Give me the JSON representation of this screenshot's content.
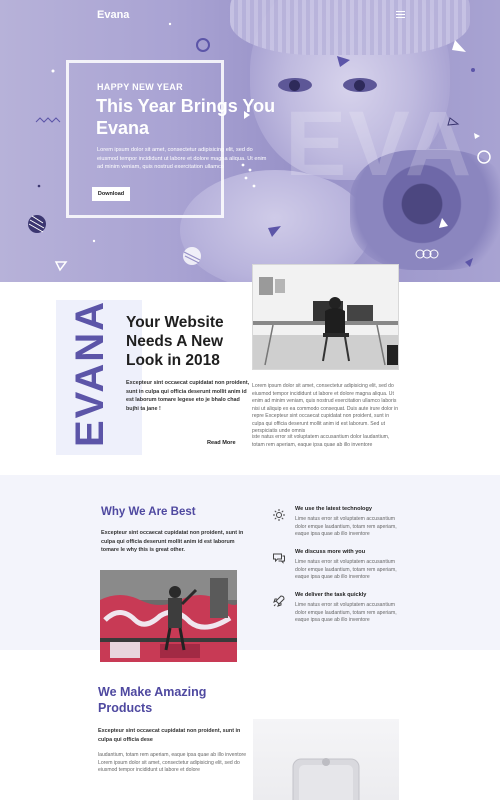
{
  "app": {
    "brand": "Evana"
  },
  "hero": {
    "eyebrow": "HAPPY NEW YEAR",
    "title": "This Year Brings You Evana",
    "body": "Lorem ipsum dolor sit amet, consectetur adipisicing elit, sed do eiusmod tempor incididunt ut labore et dolore magna aliqua. Ut enim ad minim veniam, quis nostrud exercitation ullamco",
    "button": "Download",
    "watermark": "EVA",
    "colors": {
      "overlay": "#a9a3d3",
      "accent": "#5c55a8"
    }
  },
  "intro": {
    "vertical_word": "EVANA",
    "title": "Your Website Needs A New Look in 2018",
    "text": "Excepteur sint occaecat cupidatat non proident, sunt in culpa qui officia deserunt mollit anim id est laborum tomare legese eto je bhalo chad bujhi ta jane !",
    "read_more": "Read More",
    "para1": "Lorem ipsum dolor sit amet, consectetur adipisicing elit, sed do eiusmod tempor incididunt ut labore et dolore magna aliqua. Ut enim ad minim veniam, quis nostrud exercitation ullamco laboris nisi ut aliquip ex ea commodo consequat. Duis aute irure dolor in repre Excepteur sint occaecat cupidatat non proident, sunt in culpa qui officia deserunt mollit anim id est laborum. Sed ut perspiciatis unde omnis",
    "para2": "iste natus error sit voluptatem accusantium dolor laudantium, totam rem aperiam, eaque ipsa quae ab illo inventore"
  },
  "why": {
    "title": "Why We Are Best",
    "text": "Excepteur sint occaecat cupidatat non proident, sunt in culpa qui officia deserunt mollit anim id est laborum tomare le why this is great other.",
    "features": [
      {
        "icon": "gear-icon",
        "title": "We use the latest technology",
        "text": "Lime natus error sit voluptatem accusantium dolor emque laudantium, totam rem aperiam, eaque ipsa quae ab illo inventore"
      },
      {
        "icon": "chat-icon",
        "title": "We discuss more with you",
        "text": "Lime natus error sit voluptatem accusantium dolor emque laudantium, totam rem aperiam, eaque ipsa quae ab illo inventore"
      },
      {
        "icon": "rocket-icon",
        "title": "We deliver the task quickly",
        "text": "Lime natus error sit voluptatem accusantium dolor emque laudantium, totam rem aperiam, eaque ipsa quae ab illo inventore"
      }
    ]
  },
  "products": {
    "title": "We Make Amazing Products",
    "text": "Excepteur sint occaecat cupidatat non proident, sunt in culpa qui officia dese",
    "para": "laudantium, totam rem aperiam, eaque ipsa quae ab illo inventore Lorem ipsum dolor sit amet, consectetur adipisicing elit, sed do eiusmod tempor incididunt ut labore et dolore"
  }
}
